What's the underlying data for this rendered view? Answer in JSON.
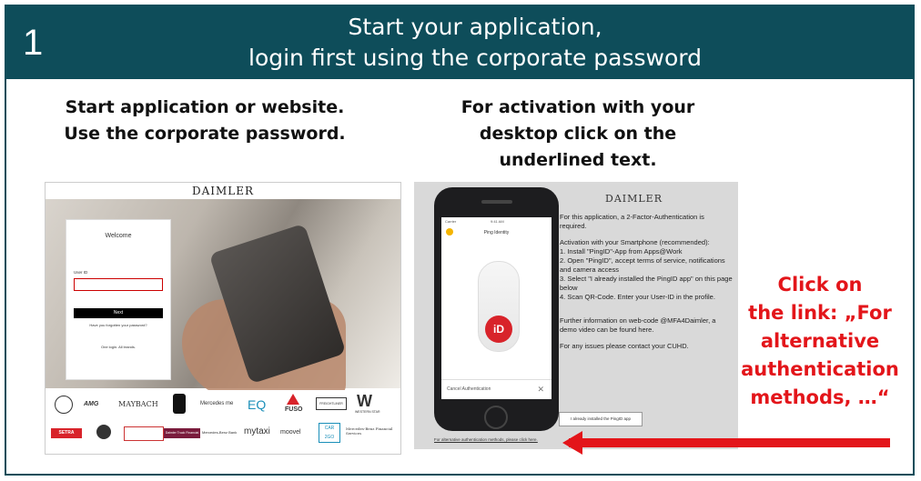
{
  "header": {
    "step": "1",
    "title_line1": "Start your application,",
    "title_line2": "login first using the corporate password"
  },
  "instructions": {
    "left_line1": "Start application or website.",
    "left_line2": "Use the corporate password.",
    "right_line1": "For activation with your",
    "right_line2": "desktop click on the",
    "right_line3": "underlined text."
  },
  "callout": {
    "line1": "Click on",
    "line2": "the link: „For",
    "line3": "alternative",
    "line4": "authentication",
    "line5": "methods, …“",
    "color": "#e3151a"
  },
  "login_screen": {
    "brand": "DAIMLER",
    "welcome": "Welcome",
    "user_id_label": "User ID",
    "next_button": "Next",
    "forgot_link": "Have you forgotten your password?",
    "one_login": "One login. All brands.",
    "logos": [
      "MAYBACH",
      "Mercedes me",
      "EQ",
      "FUSO",
      "WESTERN STAR",
      "SETRA",
      "Daimler Truck Financial",
      "Mercedes-Benz Bank",
      "mytaxi",
      "moovel",
      "CAR 2GO",
      "Mercedes-Benz Financial Services"
    ]
  },
  "pingid_screen": {
    "brand": "DAIMLER",
    "phone_status": "Carrier",
    "phone_time": "9:41 AM",
    "phone_app": "Ping Identity",
    "phone_id": "iD",
    "phone_cancel": "Cancel Authentication",
    "para1": "For this application, a 2-Factor-Authentication is required.",
    "para2_title": "Activation with your Smartphone (recommended):",
    "step1": "1. Install \"PingID\"-App from Apps@Work",
    "step2": "2. Open \"PingID\", accept terms of service, notifications and camera access",
    "step3": "3. Select \"I already installed the PingID app\" on this page below",
    "step4": "4. Scan QR-Code. Enter your User-ID in the profile.",
    "para3": "Further information on web-code @MFA4Daimler, a demo video can be found here.",
    "para4": "For any issues please contact your CUHD.",
    "already_button": "I already installed the PingID app",
    "alt_link": "For alternative authentication methods, please click here."
  },
  "colors": {
    "header_bg": "#0e4d5a",
    "accent_red": "#e3151a"
  }
}
